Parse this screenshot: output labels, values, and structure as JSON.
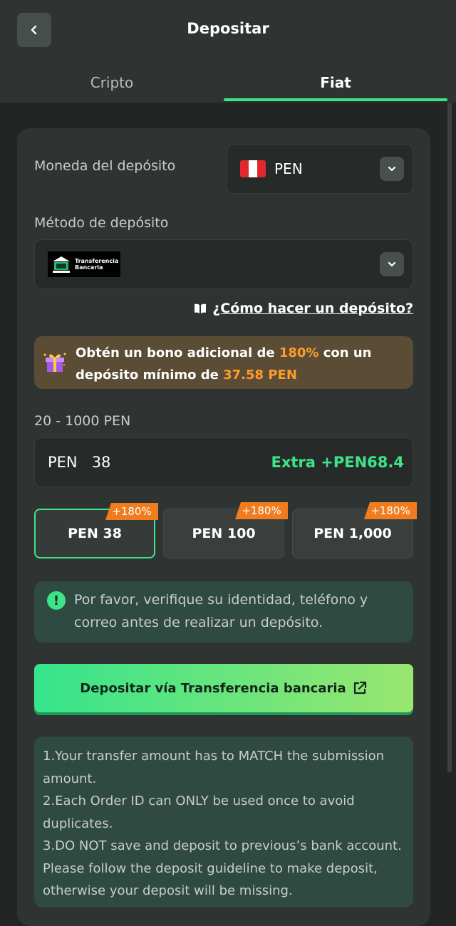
{
  "header": {
    "title": "Depositar"
  },
  "tabs": [
    {
      "label": "Cripto",
      "active": false
    },
    {
      "label": "Fiat",
      "active": true
    }
  ],
  "currency": {
    "label": "Moneda del depósito",
    "value": "PEN"
  },
  "method": {
    "label": "Método de depósito",
    "logo_text_1": "Transferencia",
    "logo_text_2": "Bancaria"
  },
  "howto": {
    "label": "¿Cómo hacer un depósito?"
  },
  "bonus": {
    "part1": "Obtén un bono adicional de ",
    "percent": "180%",
    "part2": " con un depósito mínimo de ",
    "min": "37.58 PEN"
  },
  "amount": {
    "range": "20 - 1000 PEN",
    "currency": "PEN",
    "value": "38",
    "extra": "Extra +PEN68.4"
  },
  "chips": [
    {
      "label": "PEN 38",
      "badge": "+180%",
      "selected": true
    },
    {
      "label": "PEN 100",
      "badge": "+180%",
      "selected": false
    },
    {
      "label": "PEN 1,000",
      "badge": "+180%",
      "selected": false
    }
  ],
  "notice": {
    "text": "Por favor, verifique su identidad, teléfono y correo antes de realizar un depósito."
  },
  "cta": {
    "label": "Depositar vía Transferencia bancaria"
  },
  "info": {
    "lines": [
      "1.Your transfer amount has to MATCH the submission amount.",
      "2.Each Order ID can ONLY be used once to avoid duplicates.",
      "3.DO NOT save and deposit to previous’s bank account. Please follow the deposit guideline to make deposit, otherwise your deposit will be missing."
    ]
  },
  "colors": {
    "accent": "#3de487",
    "orange": "#ff9c2a",
    "background": "#222524",
    "card": "#2f3331"
  }
}
